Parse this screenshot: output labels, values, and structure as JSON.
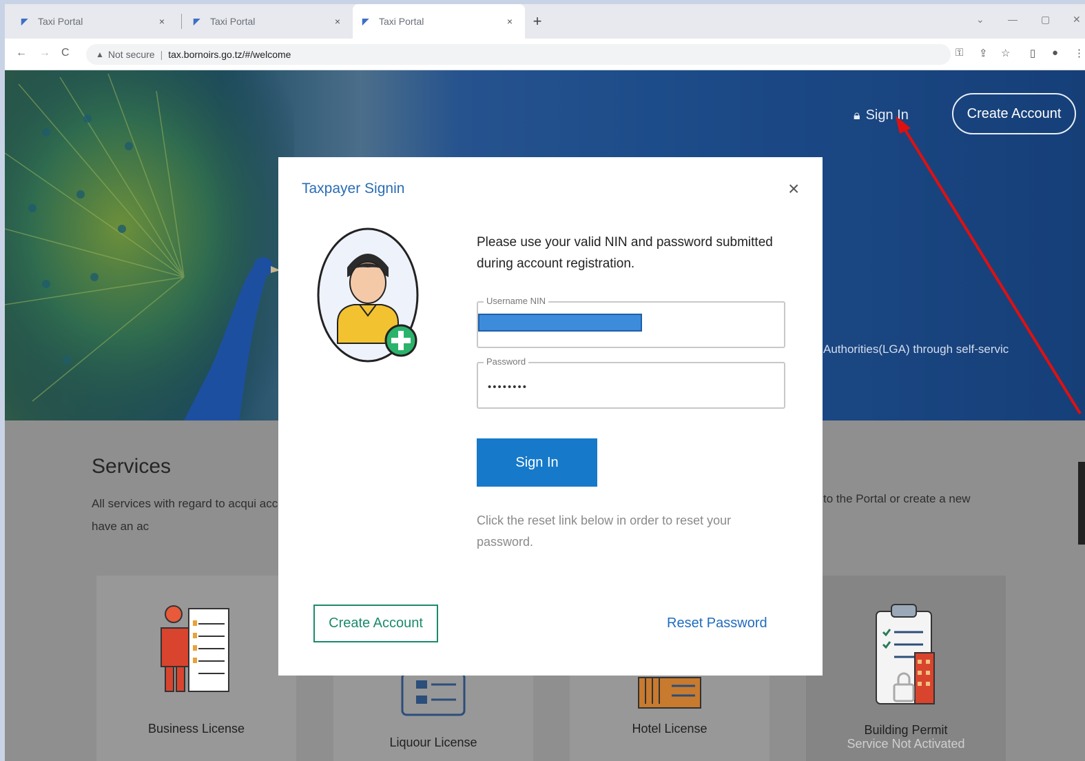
{
  "browser": {
    "tabs": [
      {
        "title": "Taxi Portal",
        "close": "×"
      },
      {
        "title": "Taxi Portal",
        "close": "×"
      },
      {
        "title": "Taxi Portal",
        "close": "×"
      }
    ],
    "new_tab": "+",
    "window_controls": [
      "⌄",
      "—",
      "▢",
      "✕"
    ],
    "nav": {
      "back": "←",
      "forward": "→",
      "reload": "C"
    },
    "address": {
      "security": "Not secure",
      "url": "tax.bornoirs.go.tz/#/welcome"
    },
    "toolbar_icons": [
      "key-icon",
      "share-icon",
      "star-icon",
      "sidebar-icon",
      "profile-icon",
      "menu-icon"
    ]
  },
  "hero": {
    "signin_label": "Sign In",
    "create_account_label": "Create Account",
    "tagline_fragment": "Authorities(LGA) through self-servic"
  },
  "services": {
    "title": "Services",
    "description": "All services with regard to acqui account if you do not have an ac",
    "description_right": "to the Portal or create a new",
    "cards": [
      {
        "label": "Business License"
      },
      {
        "label": "Liquour License"
      },
      {
        "label": "Hotel License"
      },
      {
        "label": "Building Permit",
        "status": "Service Not Activated"
      }
    ]
  },
  "modal": {
    "title": "Taxpayer Signin",
    "close": "×",
    "instructions": "Please use your valid NIN and password submitted during account registration.",
    "username_label": "Username NIN",
    "username_value": "",
    "password_label": "Password",
    "password_value": "••••••••",
    "signin_button": "Sign In",
    "reset_help": "Click the reset link below in order to reset your password.",
    "create_account_button": "Create Account",
    "reset_password_link": "Reset Password"
  },
  "colors": {
    "accent": "#1679c9",
    "create_border": "#1b8a6b",
    "link": "#1f6cbf",
    "hero_blue": "#163f78",
    "annotation_red": "#e01010"
  }
}
